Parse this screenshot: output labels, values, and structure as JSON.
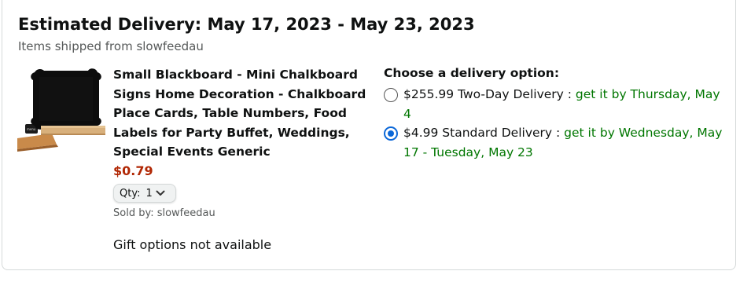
{
  "header": {
    "title": "Estimated Delivery: May 17, 2023 - May 23, 2023",
    "shipped_from": "Items shipped from slowfeedau"
  },
  "product": {
    "name": "Small Blackboard - Mini Chalkboard Signs Home Decoration - Chalkboard Place Cards, Table Numbers, Food Labels for Party Buffet, Weddings, Special Events Generic",
    "price": "$0.79",
    "qty_label": "Qty:",
    "qty_value": "1",
    "sold_by": "Sold by: slowfeedau",
    "gift": "Gift options not available"
  },
  "delivery": {
    "heading": "Choose a delivery option:",
    "options": [
      {
        "price_label": "$255.99 Two-Day Delivery : ",
        "eta": "get it by Thursday, May 4",
        "selected": false
      },
      {
        "price_label": "$4.99 Standard Delivery : ",
        "eta": "get it by Wednesday, May 17 - Tuesday, May 23",
        "selected": true
      }
    ]
  },
  "colors": {
    "price": "#b12704",
    "eta": "#007600",
    "radio_selected": "#0a67d8"
  },
  "icons": {
    "qty_dropdown": "chevron-down-icon"
  }
}
